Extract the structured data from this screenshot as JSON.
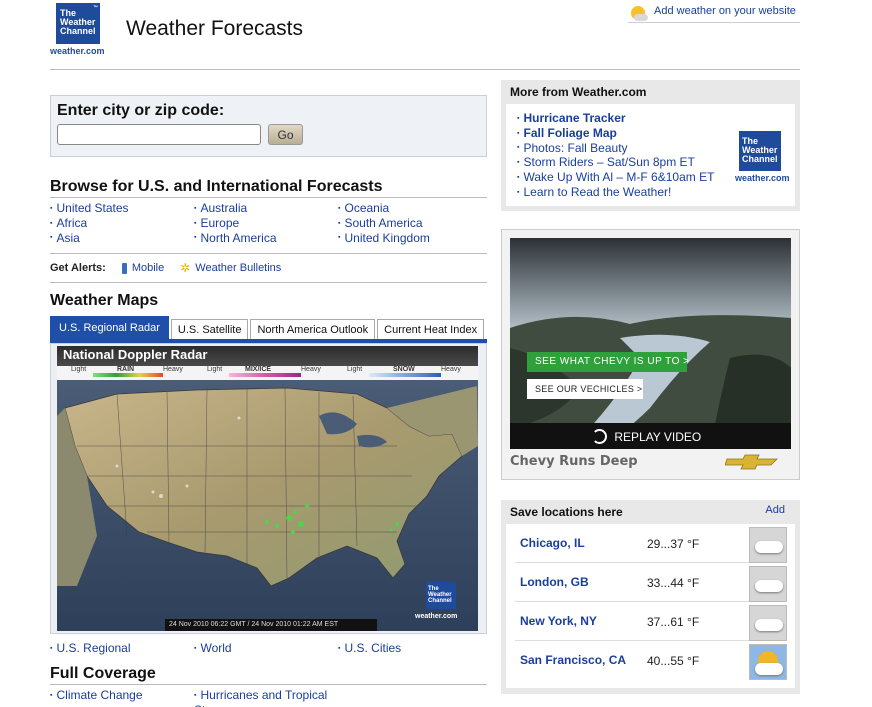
{
  "header": {
    "logo_lines": [
      "The",
      "Weather",
      "Channel"
    ],
    "logo_url": "weather.com",
    "title": "Weather Forecasts",
    "add_weather": "Add weather on your website"
  },
  "search": {
    "label": "Enter city or zip code:",
    "value": "",
    "placeholder": "",
    "button": "Go"
  },
  "browse": {
    "heading": "Browse for U.S. and International Forecasts",
    "items": [
      "United States",
      "Australia",
      "Oceania",
      "Africa",
      "Europe",
      "South America",
      "Asia",
      "North America",
      "United Kingdom"
    ]
  },
  "alerts": {
    "label": "Get Alerts:",
    "mobile": "Mobile",
    "bulletins": "Weather Bulletins"
  },
  "maps": {
    "heading": "Weather Maps",
    "tabs": [
      "U.S. Regional Radar",
      "U.S. Satellite",
      "North America Outlook",
      "Current Heat Index"
    ],
    "active_tab": 0,
    "map_title": "National Doppler Radar",
    "legend": {
      "rain": "RAIN",
      "mix": "MIX/ICE",
      "snow": "SNOW",
      "light": "Light",
      "heavy": "Heavy"
    },
    "timestamp": "24 Nov 2010 06:22 GMT / 24 Nov 2010 01:22 AM EST",
    "map_logo_url": "weather.com",
    "links": [
      "U.S. Regional",
      "World",
      "U.S. Cities"
    ]
  },
  "coverage": {
    "heading": "Full Coverage",
    "items": [
      "Climate Change",
      "Hurricanes and Tropical Storms"
    ]
  },
  "more": {
    "heading": "More from Weather.com",
    "items": [
      {
        "label": "Hurricane Tracker",
        "bold": true
      },
      {
        "label": "Fall Foliage Map",
        "bold": true
      },
      {
        "label": "Photos: Fall Beauty",
        "bold": false
      },
      {
        "label": "Storm Riders – Sat/Sun 8pm ET",
        "bold": false
      },
      {
        "label": "Wake Up With Al – M-F 6&10am ET",
        "bold": false
      },
      {
        "label": "Learn to Read the Weather!",
        "bold": false
      }
    ],
    "logo_url": "weather.com"
  },
  "ad": {
    "btn1": "SEE WHAT CHEVY IS UP TO >",
    "btn2": "SEE OUR VECHICLES >",
    "replay": "REPLAY VIDEO",
    "tagline": "Chevy Runs Deep"
  },
  "saved": {
    "heading": "Save locations here",
    "add": "Add",
    "locations": [
      {
        "city": "Chicago, IL",
        "temp": "29...37 °F",
        "icon": "cloudy-icon"
      },
      {
        "city": "London, GB",
        "temp": "33...44 °F",
        "icon": "cloudy-icon"
      },
      {
        "city": "New York, NY",
        "temp": "37...61 °F",
        "icon": "cloudy-icon"
      },
      {
        "city": "San Francisco, CA",
        "temp": "40...55 °F",
        "icon": "partly-sunny-icon"
      }
    ]
  },
  "colors": {
    "brand_blue": "#1f4b9d",
    "link": "#1a3e9c",
    "tab_active": "#1f4fa8",
    "chevy_green": "#2ea13a"
  }
}
